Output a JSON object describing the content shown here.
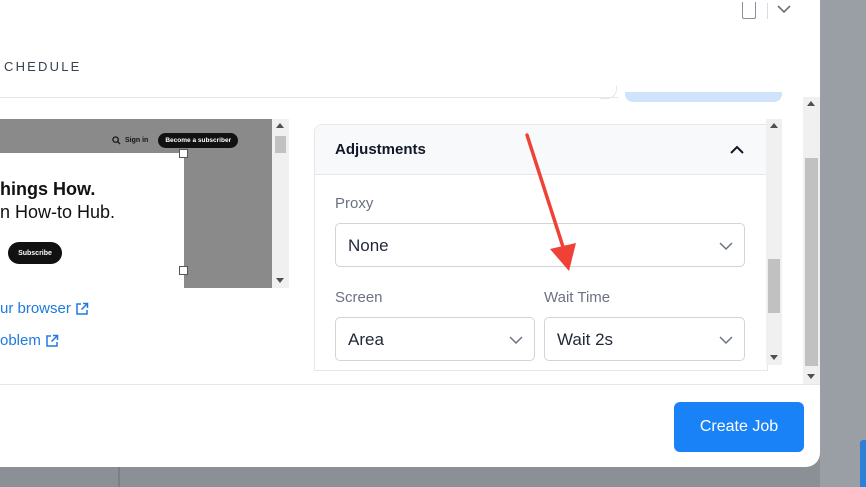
{
  "header": {
    "tab_label": "CHEDULE"
  },
  "preview": {
    "signin": "Sign in",
    "become_subscriber": "Become a subscriber",
    "headline_1": "hings How.",
    "headline_2": "n How-to Hub.",
    "subscribe_button": "Subscribe"
  },
  "links": {
    "browser": "ur browser",
    "problem": "oblem"
  },
  "adjustments": {
    "title": "Adjustments",
    "proxy_label": "Proxy",
    "proxy_value": "None",
    "screen_label": "Screen",
    "screen_value": "Area",
    "wait_label": "Wait Time",
    "wait_value": "Wait 2s"
  },
  "footer": {
    "create_job": "Create Job"
  },
  "colors": {
    "primary_button": "#1a82f7",
    "link": "#1f7ae0",
    "annotation_arrow": "#ef4136"
  }
}
